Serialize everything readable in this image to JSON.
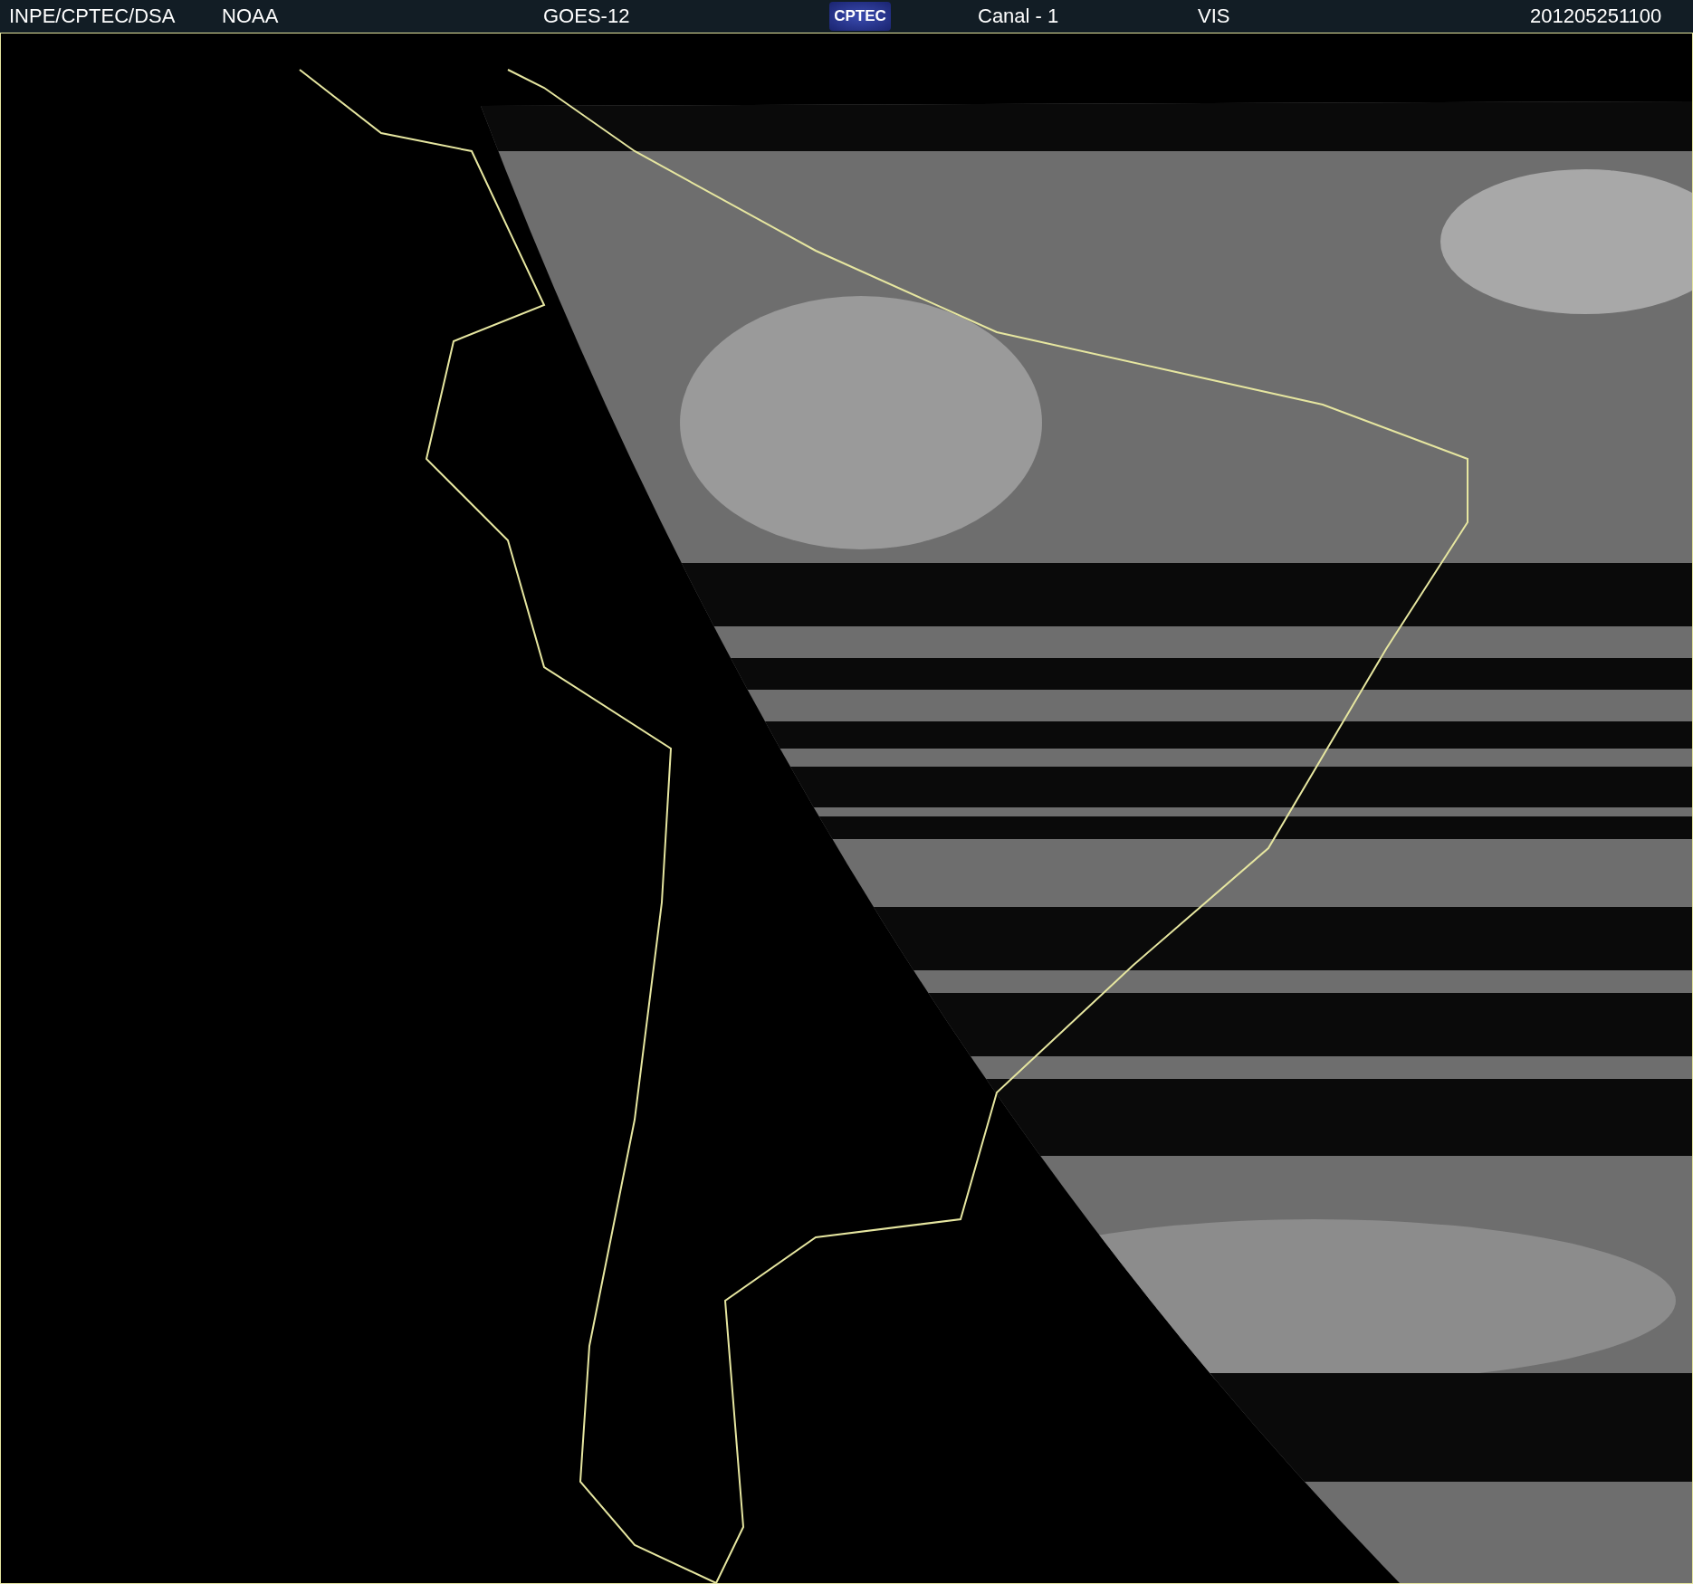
{
  "header": {
    "items": [
      {
        "kind": "text",
        "text": "INPE/CPTEC/DSA"
      },
      {
        "kind": "text",
        "text": "NOAA"
      },
      {
        "kind": "text",
        "text": "GOES-12"
      },
      {
        "kind": "logo",
        "text": "CPTEC"
      },
      {
        "kind": "text",
        "text": "Canal - 1"
      },
      {
        "kind": "text",
        "text": "VIS"
      },
      {
        "kind": "text",
        "text": "201205251100"
      }
    ]
  }
}
